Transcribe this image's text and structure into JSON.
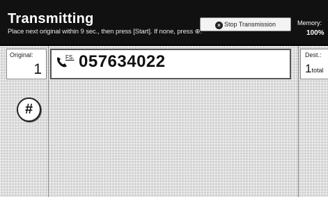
{
  "header": {
    "title": "Transmitting",
    "message": "Place next original within      9 sec., then press [Start]. If none, press ⊕.",
    "stop_button": "Stop Transmission",
    "memory_label": "Memory:",
    "memory_value": "100%"
  },
  "original": {
    "label": "Original:",
    "count": "1"
  },
  "fax": {
    "tag": "FS.",
    "number": "057634022"
  },
  "destination": {
    "label": "Dest.:",
    "count": "1",
    "suffix": "total"
  },
  "keypad": {
    "hash": "#"
  },
  "icons": {
    "stop": "stop-icon",
    "phone": "phone-icon"
  }
}
